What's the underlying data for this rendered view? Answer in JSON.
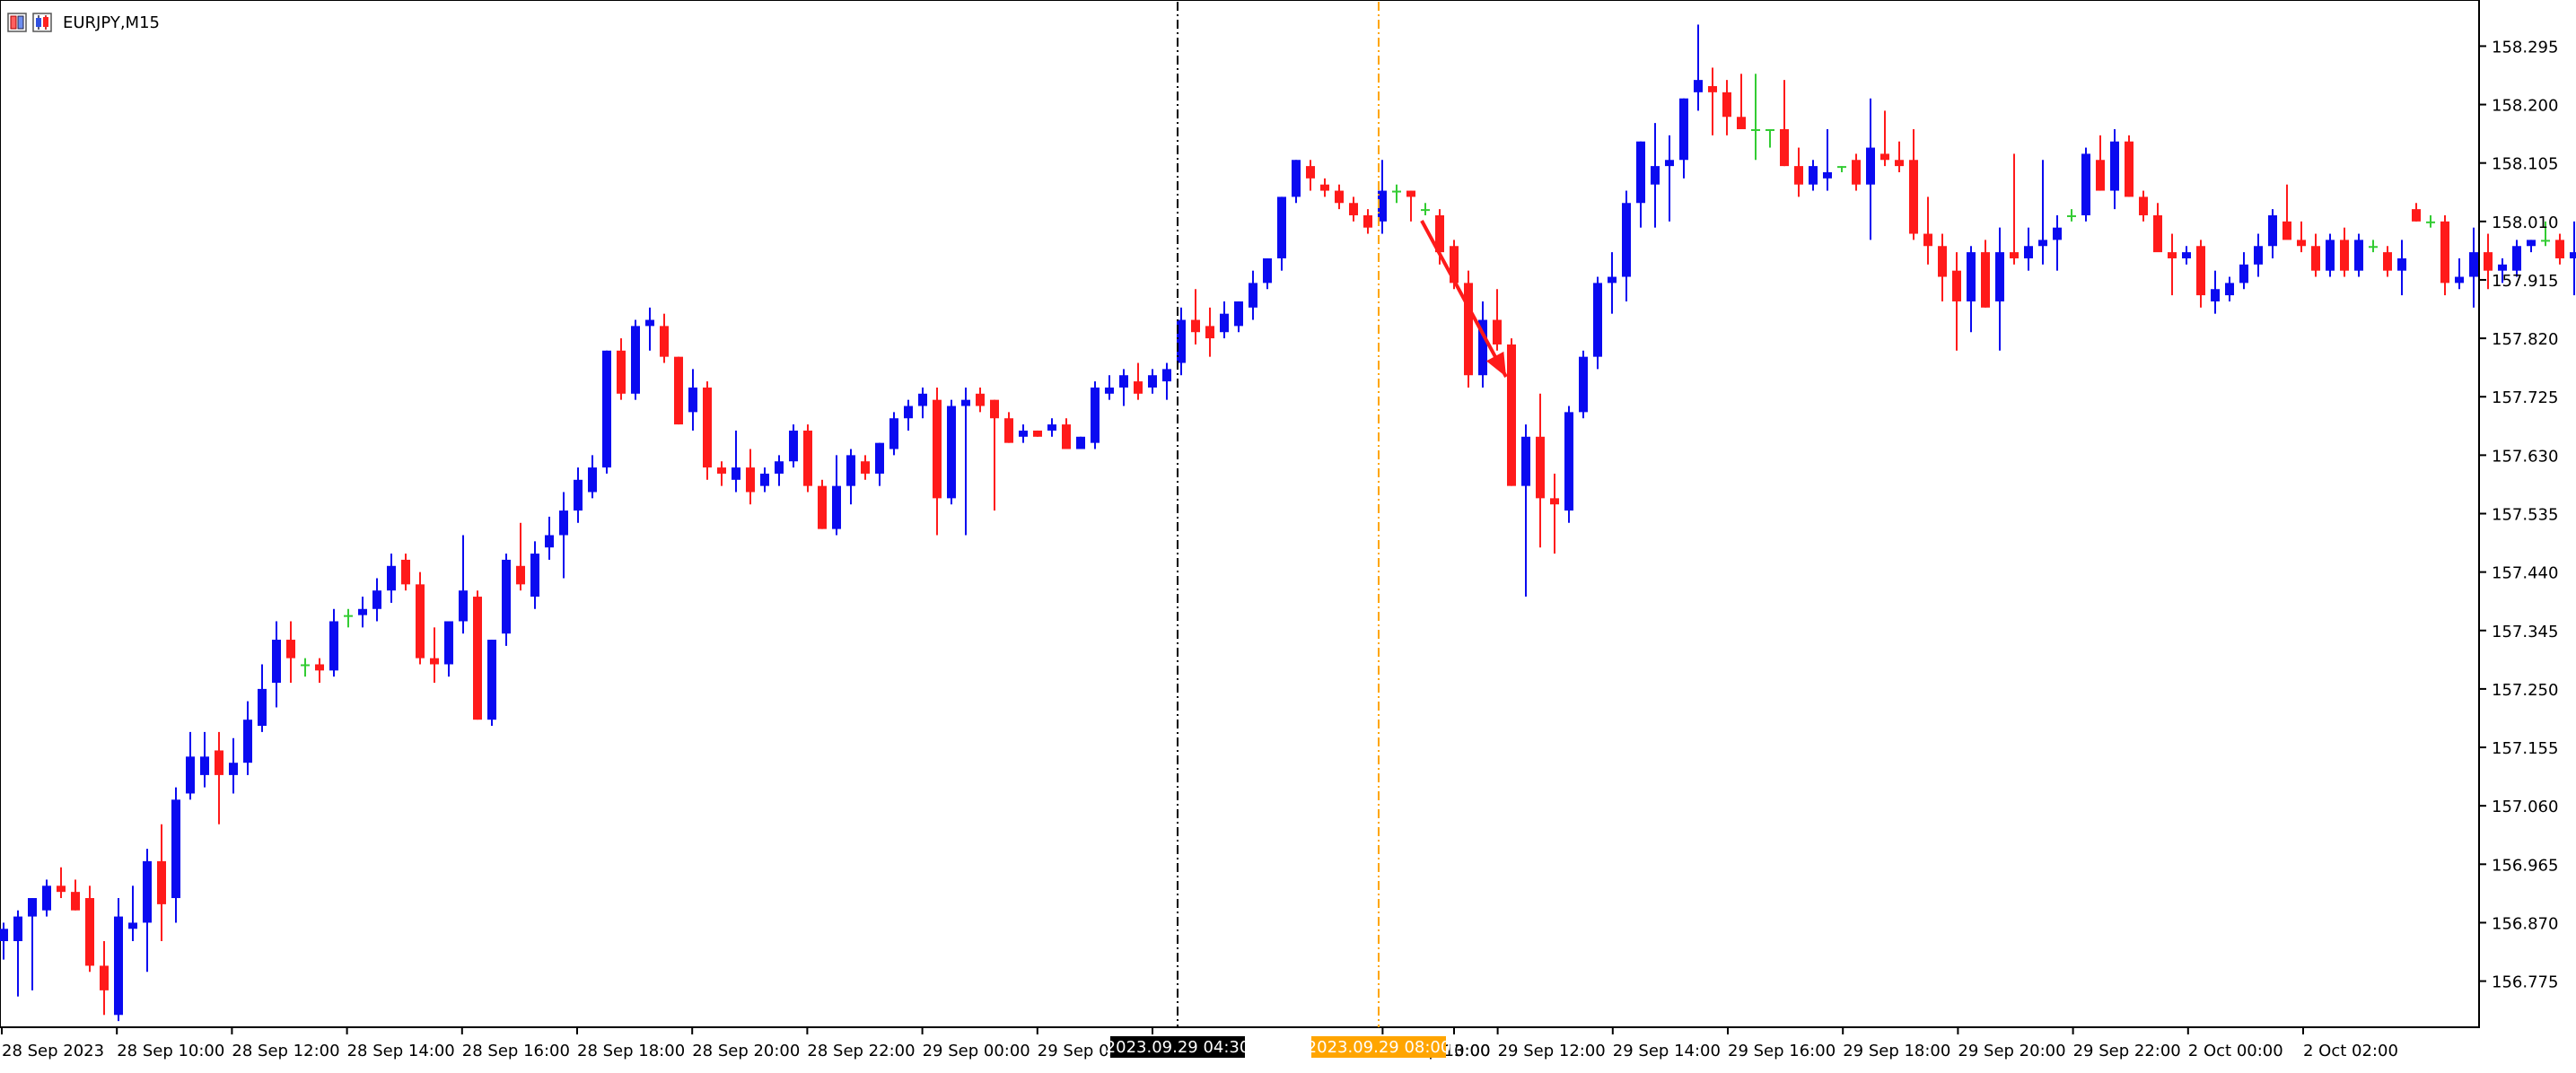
{
  "window": {
    "symbol_label": "EURJPY,M15"
  },
  "colors": {
    "background": "#ffffff",
    "bull": "#0a0af0",
    "bear": "#ff1a1a",
    "doji": "#33cc33",
    "axis": "#000000",
    "text": "#000000",
    "crosshair": "#000000",
    "marker_line": "#ffa500",
    "arrow": "#ff1a1a"
  },
  "icons": [
    "bar-chart-icon",
    "candle-chart-icon"
  ],
  "price_axis": {
    "labels": [
      "158.295",
      "158.200",
      "158.105",
      "158.010",
      "157.915",
      "157.820",
      "157.725",
      "157.630",
      "157.535",
      "157.440",
      "157.345",
      "157.250",
      "157.155",
      "157.060",
      "156.965",
      "156.870",
      "156.775"
    ]
  },
  "time_axis": {
    "labels": [
      "28 Sep 2023",
      "28 Sep 10:00",
      "28 Sep 12:00",
      "28 Sep 14:00",
      "28 Sep 16:00",
      "28 Sep 18:00",
      "28 Sep 20:00",
      "28 Sep 22:00",
      "29 Sep 00:00",
      "29 Sep 02",
      "29 Se",
      "3:00",
      "29 Sep 10:00",
      "29 Sep 12:00",
      "29 Sep 14:00",
      "29 Sep 16:00",
      "29 Sep 18:00",
      "29 Sep 20:00",
      "29 Sep 22:00",
      "2 Oct 00:00",
      "2 Oct 02:00"
    ],
    "crosshair_label": "2023.09.29 04:30",
    "marker_label": "2023.09.29 08:00"
  },
  "chart_data": {
    "type": "candlestick",
    "symbol": "EURJPY",
    "timeframe": "M15",
    "ylim": [
      156.7,
      158.37
    ],
    "candles": [
      [
        156.84,
        156.87,
        156.81,
        156.86
      ],
      [
        156.84,
        156.89,
        156.75,
        156.88
      ],
      [
        156.88,
        156.91,
        156.76,
        156.91
      ],
      [
        156.89,
        156.94,
        156.88,
        156.93
      ],
      [
        156.93,
        156.96,
        156.91,
        156.92
      ],
      [
        156.92,
        156.94,
        156.89,
        156.89
      ],
      [
        156.91,
        156.93,
        156.79,
        156.8
      ],
      [
        156.8,
        156.84,
        156.72,
        156.76
      ],
      [
        156.72,
        156.91,
        156.71,
        156.88
      ],
      [
        156.86,
        156.93,
        156.84,
        156.87
      ],
      [
        156.87,
        156.99,
        156.79,
        156.97
      ],
      [
        156.97,
        157.03,
        156.84,
        156.9
      ],
      [
        156.91,
        157.09,
        156.87,
        157.07
      ],
      [
        157.08,
        157.18,
        157.07,
        157.14
      ],
      [
        157.11,
        157.18,
        157.09,
        157.14
      ],
      [
        157.15,
        157.18,
        157.03,
        157.11
      ],
      [
        157.11,
        157.17,
        157.08,
        157.13
      ],
      [
        157.13,
        157.23,
        157.11,
        157.2
      ],
      [
        157.19,
        157.29,
        157.18,
        157.25
      ],
      [
        157.26,
        157.36,
        157.22,
        157.33
      ],
      [
        157.33,
        157.36,
        157.26,
        157.3
      ],
      [
        157.29,
        157.3,
        157.27,
        157.29
      ],
      [
        157.29,
        157.3,
        157.26,
        157.28
      ],
      [
        157.28,
        157.38,
        157.27,
        157.36
      ],
      [
        157.37,
        157.38,
        157.35,
        157.37
      ],
      [
        157.37,
        157.4,
        157.35,
        157.38
      ],
      [
        157.38,
        157.43,
        157.36,
        157.41
      ],
      [
        157.41,
        157.47,
        157.39,
        157.45
      ],
      [
        157.46,
        157.47,
        157.41,
        157.42
      ],
      [
        157.42,
        157.44,
        157.29,
        157.3
      ],
      [
        157.3,
        157.35,
        157.26,
        157.29
      ],
      [
        157.29,
        157.36,
        157.27,
        157.36
      ],
      [
        157.36,
        157.5,
        157.34,
        157.41
      ],
      [
        157.4,
        157.41,
        157.2,
        157.2
      ],
      [
        157.2,
        157.33,
        157.19,
        157.33
      ],
      [
        157.34,
        157.47,
        157.32,
        157.46
      ],
      [
        157.45,
        157.52,
        157.41,
        157.42
      ],
      [
        157.4,
        157.49,
        157.38,
        157.47
      ],
      [
        157.48,
        157.53,
        157.46,
        157.5
      ],
      [
        157.5,
        157.57,
        157.43,
        157.54
      ],
      [
        157.54,
        157.61,
        157.52,
        157.59
      ],
      [
        157.57,
        157.63,
        157.56,
        157.61
      ],
      [
        157.61,
        157.8,
        157.6,
        157.8
      ],
      [
        157.8,
        157.82,
        157.72,
        157.73
      ],
      [
        157.73,
        157.85,
        157.72,
        157.84
      ],
      [
        157.84,
        157.87,
        157.8,
        157.85
      ],
      [
        157.84,
        157.86,
        157.78,
        157.79
      ],
      [
        157.79,
        157.79,
        157.68,
        157.68
      ],
      [
        157.7,
        157.77,
        157.67,
        157.74
      ],
      [
        157.74,
        157.75,
        157.59,
        157.61
      ],
      [
        157.61,
        157.62,
        157.58,
        157.6
      ],
      [
        157.59,
        157.67,
        157.57,
        157.61
      ],
      [
        157.61,
        157.64,
        157.55,
        157.57
      ],
      [
        157.58,
        157.61,
        157.57,
        157.6
      ],
      [
        157.6,
        157.63,
        157.58,
        157.62
      ],
      [
        157.62,
        157.68,
        157.61,
        157.67
      ],
      [
        157.67,
        157.68,
        157.57,
        157.58
      ],
      [
        157.58,
        157.59,
        157.51,
        157.51
      ],
      [
        157.51,
        157.63,
        157.5,
        157.58
      ],
      [
        157.58,
        157.64,
        157.55,
        157.63
      ],
      [
        157.62,
        157.63,
        157.59,
        157.6
      ],
      [
        157.6,
        157.65,
        157.58,
        157.65
      ],
      [
        157.64,
        157.7,
        157.63,
        157.69
      ],
      [
        157.69,
        157.72,
        157.67,
        157.71
      ],
      [
        157.71,
        157.74,
        157.69,
        157.73
      ],
      [
        157.72,
        157.74,
        157.5,
        157.56
      ],
      [
        157.56,
        157.72,
        157.55,
        157.71
      ],
      [
        157.71,
        157.74,
        157.5,
        157.72
      ],
      [
        157.73,
        157.74,
        157.7,
        157.71
      ],
      [
        157.72,
        157.72,
        157.54,
        157.69
      ],
      [
        157.69,
        157.7,
        157.65,
        157.65
      ],
      [
        157.66,
        157.68,
        157.65,
        157.67
      ],
      [
        157.67,
        157.67,
        157.66,
        157.66
      ],
      [
        157.67,
        157.69,
        157.66,
        157.68
      ],
      [
        157.68,
        157.69,
        157.64,
        157.64
      ],
      [
        157.64,
        157.66,
        157.64,
        157.66
      ],
      [
        157.65,
        157.75,
        157.64,
        157.74
      ],
      [
        157.73,
        157.76,
        157.72,
        157.74
      ],
      [
        157.74,
        157.77,
        157.71,
        157.76
      ],
      [
        157.75,
        157.78,
        157.72,
        157.73
      ],
      [
        157.74,
        157.77,
        157.73,
        157.76
      ],
      [
        157.75,
        157.78,
        157.72,
        157.77
      ],
      [
        157.78,
        157.87,
        157.76,
        157.85
      ],
      [
        157.85,
        157.9,
        157.81,
        157.83
      ],
      [
        157.84,
        157.87,
        157.79,
        157.82
      ],
      [
        157.83,
        157.88,
        157.82,
        157.86
      ],
      [
        157.84,
        157.88,
        157.83,
        157.88
      ],
      [
        157.87,
        157.93,
        157.85,
        157.91
      ],
      [
        157.91,
        157.95,
        157.9,
        157.95
      ],
      [
        157.95,
        158.05,
        157.93,
        158.05
      ],
      [
        158.05,
        158.11,
        158.04,
        158.11
      ],
      [
        158.1,
        158.11,
        158.06,
        158.08
      ],
      [
        158.07,
        158.08,
        158.05,
        158.06
      ],
      [
        158.06,
        158.07,
        158.03,
        158.04
      ],
      [
        158.04,
        158.05,
        158.01,
        158.02
      ],
      [
        158.02,
        158.03,
        157.99,
        158.0
      ],
      [
        158.01,
        158.11,
        157.99,
        158.06
      ],
      [
        158.06,
        158.07,
        158.04,
        158.06
      ],
      [
        158.06,
        158.06,
        158.01,
        158.05
      ],
      [
        158.03,
        158.04,
        158.02,
        158.03
      ],
      [
        158.02,
        158.03,
        157.94,
        157.96
      ],
      [
        157.97,
        157.98,
        157.9,
        157.91
      ],
      [
        157.91,
        157.93,
        157.74,
        157.76
      ],
      [
        157.76,
        157.88,
        157.74,
        157.85
      ],
      [
        157.85,
        157.9,
        157.8,
        157.81
      ],
      [
        157.81,
        157.82,
        157.58,
        157.58
      ],
      [
        157.58,
        157.68,
        157.4,
        157.66
      ],
      [
        157.66,
        157.73,
        157.48,
        157.56
      ],
      [
        157.56,
        157.6,
        157.47,
        157.55
      ],
      [
        157.54,
        157.71,
        157.52,
        157.7
      ],
      [
        157.7,
        157.8,
        157.69,
        157.79
      ],
      [
        157.79,
        157.92,
        157.77,
        157.91
      ],
      [
        157.91,
        157.96,
        157.86,
        157.92
      ],
      [
        157.92,
        158.06,
        157.88,
        158.04
      ],
      [
        158.04,
        158.14,
        158.0,
        158.14
      ],
      [
        158.07,
        158.17,
        158.0,
        158.1
      ],
      [
        158.1,
        158.15,
        158.01,
        158.11
      ],
      [
        158.11,
        158.21,
        158.08,
        158.21
      ],
      [
        158.22,
        158.33,
        158.19,
        158.24
      ],
      [
        158.23,
        158.26,
        158.15,
        158.22
      ],
      [
        158.22,
        158.24,
        158.15,
        158.18
      ],
      [
        158.18,
        158.25,
        158.17,
        158.16
      ],
      [
        158.16,
        158.25,
        158.11,
        158.16
      ],
      [
        158.16,
        158.16,
        158.13,
        158.16
      ],
      [
        158.16,
        158.24,
        158.1,
        158.1
      ],
      [
        158.1,
        158.13,
        158.05,
        158.07
      ],
      [
        158.07,
        158.11,
        158.06,
        158.1
      ],
      [
        158.08,
        158.16,
        158.06,
        158.09
      ],
      [
        158.1,
        158.1,
        158.09,
        158.1
      ],
      [
        158.11,
        158.12,
        158.06,
        158.07
      ],
      [
        158.07,
        158.21,
        157.98,
        158.13
      ],
      [
        158.12,
        158.19,
        158.1,
        158.11
      ],
      [
        158.11,
        158.14,
        158.09,
        158.1
      ],
      [
        158.11,
        158.16,
        157.98,
        157.99
      ],
      [
        157.99,
        158.05,
        157.94,
        157.97
      ],
      [
        157.97,
        157.99,
        157.88,
        157.92
      ],
      [
        157.93,
        157.96,
        157.8,
        157.88
      ],
      [
        157.88,
        157.97,
        157.83,
        157.96
      ],
      [
        157.96,
        157.98,
        157.87,
        157.87
      ],
      [
        157.88,
        158.0,
        157.8,
        157.96
      ],
      [
        157.96,
        158.12,
        157.94,
        157.95
      ],
      [
        157.95,
        158.0,
        157.93,
        157.97
      ],
      [
        157.97,
        158.11,
        157.94,
        157.98
      ],
      [
        157.98,
        158.02,
        157.93,
        158.0
      ],
      [
        158.02,
        158.03,
        158.01,
        158.02
      ],
      [
        158.02,
        158.13,
        158.01,
        158.12
      ],
      [
        158.11,
        158.15,
        158.06,
        158.06
      ],
      [
        158.06,
        158.16,
        158.03,
        158.14
      ],
      [
        158.14,
        158.15,
        158.05,
        158.05
      ],
      [
        158.05,
        158.06,
        158.01,
        158.02
      ],
      [
        158.02,
        158.04,
        157.97,
        157.96
      ],
      [
        157.96,
        157.99,
        157.89,
        157.95
      ],
      [
        157.95,
        157.97,
        157.94,
        157.96
      ],
      [
        157.97,
        157.98,
        157.87,
        157.89
      ],
      [
        157.88,
        157.93,
        157.86,
        157.9
      ],
      [
        157.89,
        157.92,
        157.88,
        157.91
      ],
      [
        157.91,
        157.96,
        157.9,
        157.94
      ],
      [
        157.94,
        157.99,
        157.92,
        157.97
      ],
      [
        157.97,
        158.03,
        157.95,
        158.02
      ],
      [
        158.01,
        158.07,
        157.99,
        157.98
      ],
      [
        157.98,
        158.01,
        157.96,
        157.97
      ],
      [
        157.97,
        157.99,
        157.92,
        157.93
      ],
      [
        157.93,
        157.99,
        157.92,
        157.98
      ],
      [
        157.98,
        158.0,
        157.92,
        157.93
      ],
      [
        157.93,
        157.99,
        157.92,
        157.98
      ],
      [
        157.97,
        157.98,
        157.96,
        157.97
      ],
      [
        157.96,
        157.97,
        157.92,
        157.93
      ],
      [
        157.93,
        157.98,
        157.89,
        157.95
      ],
      [
        158.03,
        158.04,
        158.01,
        158.01
      ],
      [
        158.01,
        158.02,
        158.0,
        158.01
      ],
      [
        158.01,
        158.02,
        157.89,
        157.91
      ],
      [
        157.91,
        157.95,
        157.9,
        157.92
      ],
      [
        157.92,
        158.0,
        157.87,
        157.96
      ],
      [
        157.96,
        157.99,
        157.9,
        157.93
      ],
      [
        157.93,
        157.95,
        157.91,
        157.94
      ],
      [
        157.93,
        157.98,
        157.92,
        157.97
      ],
      [
        157.97,
        157.98,
        157.96,
        157.98
      ],
      [
        157.98,
        158.01,
        157.97,
        157.98
      ],
      [
        157.98,
        157.99,
        157.94,
        157.95
      ],
      [
        157.95,
        158.01,
        157.89,
        157.96
      ]
    ]
  }
}
